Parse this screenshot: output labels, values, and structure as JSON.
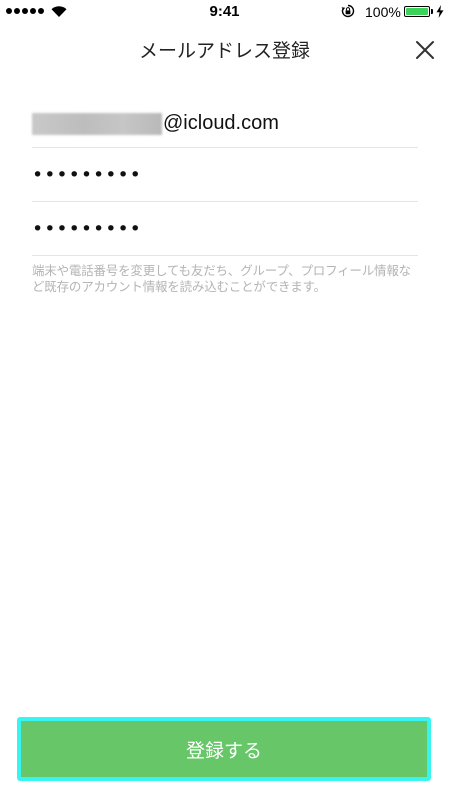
{
  "status_bar": {
    "time": "9:41",
    "battery_percent": "100%",
    "battery_level": 1.0,
    "signal_bars": 5,
    "icons": [
      "signal-dots-icon",
      "wifi-icon",
      "rotation-lock-icon",
      "battery-icon",
      "charging-bolt-icon"
    ]
  },
  "nav": {
    "title": "メールアドレス登録",
    "close_icon": "close-icon"
  },
  "form": {
    "email_domain": "@icloud.com",
    "password": "•••••••••",
    "password_confirm": "•••••••••",
    "note": "端末や電話番号を変更しても友だち、グループ、プロフィール情報など既存のアカウント情報を読み込むことができます。"
  },
  "footer": {
    "register_label": "登録する"
  },
  "colors": {
    "primary_button": "#66c668",
    "button_highlight": "#38f5f2",
    "note_text": "#b4b4b4",
    "battery_fill": "#3bd35a"
  }
}
